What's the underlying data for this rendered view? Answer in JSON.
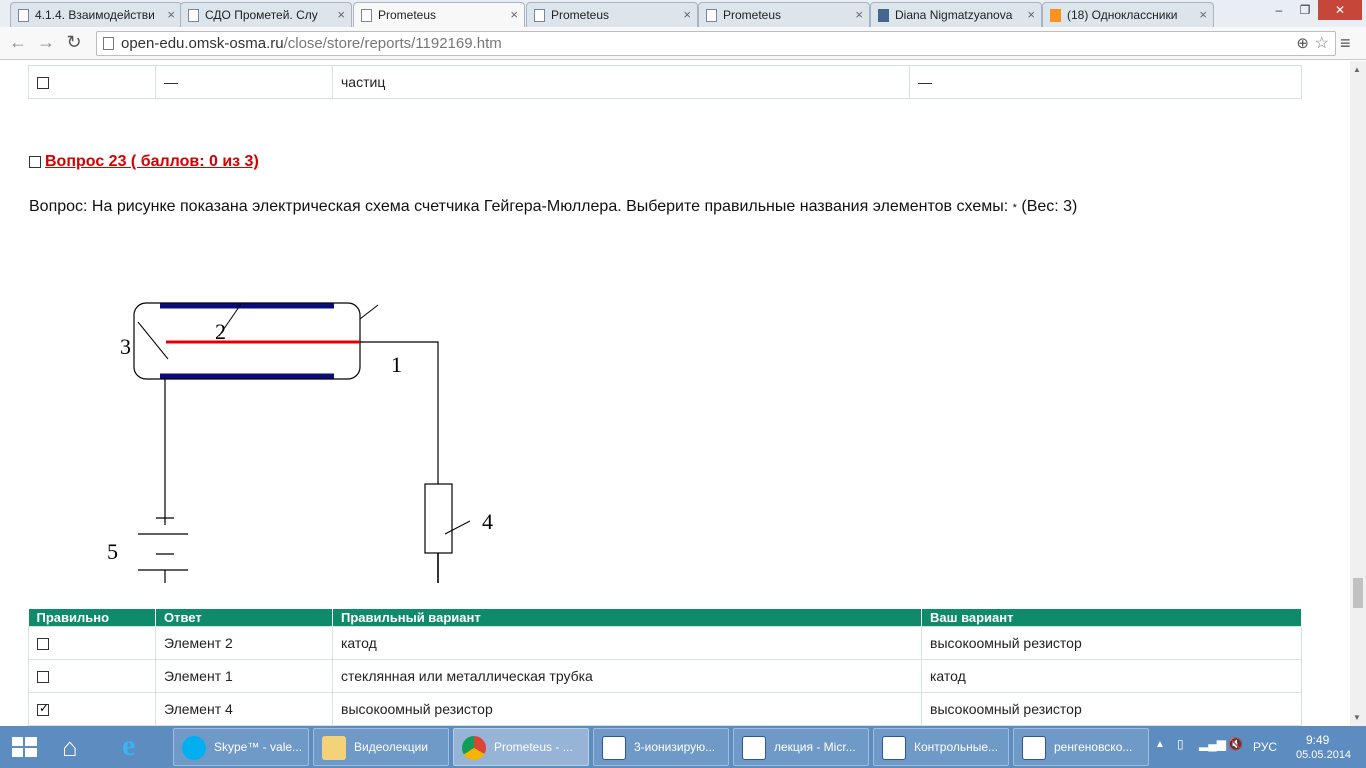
{
  "browser": {
    "tabs": [
      {
        "title": "4.1.4. Взаимодействи",
        "active": false
      },
      {
        "title": "СДО Прометей. Слу",
        "active": false
      },
      {
        "title": "Prometeus",
        "active": true
      },
      {
        "title": "Prometeus",
        "active": false
      },
      {
        "title": "Prometeus",
        "active": false
      },
      {
        "title": "Diana Nigmatzyanova",
        "active": false
      },
      {
        "title": "(18) Одноклассники",
        "active": false
      }
    ],
    "url_host": "open-edu.omsk-osma.ru",
    "url_path": "/close/store/reports/1192169.htm"
  },
  "top_row": {
    "col2": "—",
    "col3": "частиц",
    "col4": "—"
  },
  "question": {
    "title": "Вопрос 23  ( баллов: 0 из 3)",
    "text": "Вопрос: На рисунке показана электрическая схема счетчика Гейгера-Мюллера. Выберите правильные названия элементов схемы:",
    "required_mark": "*",
    "weight": "(Вес: 3)"
  },
  "diagram": {
    "labels": [
      "1",
      "2",
      "3",
      "4",
      "5"
    ],
    "colors": {
      "electrode": "#0b0b7a",
      "anode": "#e00000",
      "wire": "#000000"
    }
  },
  "answers_table": {
    "headers": [
      "Правильно",
      "Ответ",
      "Правильный вариант",
      "Ваш вариант"
    ],
    "rows": [
      {
        "correct": false,
        "answer": "Элемент 2",
        "right": "катод",
        "yours": "высокоомный резистор"
      },
      {
        "correct": false,
        "answer": "Элемент 1",
        "right": "стеклянная или металлическая трубка",
        "yours": "катод"
      },
      {
        "correct": true,
        "answer": "Элемент 4",
        "right": "высокоомный резистор",
        "yours": "высокоомный резистор"
      }
    ]
  },
  "taskbar": {
    "buttons": [
      "Skype™ - vale...",
      "Видеолекции",
      "Prometeus - ...",
      "3-ионизирую...",
      "лекция - Micr...",
      "Контрольные...",
      "ренгеновско..."
    ],
    "lang": "РУС",
    "time": "9:49",
    "date": "05.05.2014"
  }
}
